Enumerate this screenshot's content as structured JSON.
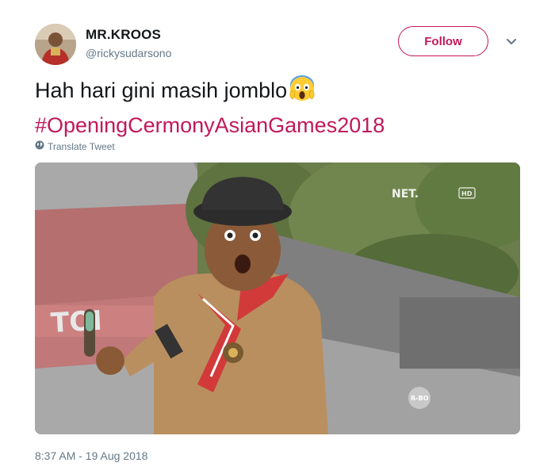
{
  "user": {
    "name": "MR.KROOS",
    "handle": "@rickysudarsono"
  },
  "follow_button": {
    "label": "Follow"
  },
  "tweet": {
    "text": "Hah hari gini masih jomblo",
    "emoji": "scream-emoji",
    "hashtag": "#OpeningCermonyAsianGames2018",
    "translate_label": "Translate Tweet",
    "timestamp": "8:37 AM - 19 Aug 2018"
  },
  "media": {
    "watermark": "NET.",
    "quality_badge": "HD",
    "corner_logo": "R-BO",
    "road_text": "TOI"
  },
  "colors": {
    "accent": "#c2185b",
    "secondary_text": "#657786",
    "primary_text": "#14171a"
  }
}
